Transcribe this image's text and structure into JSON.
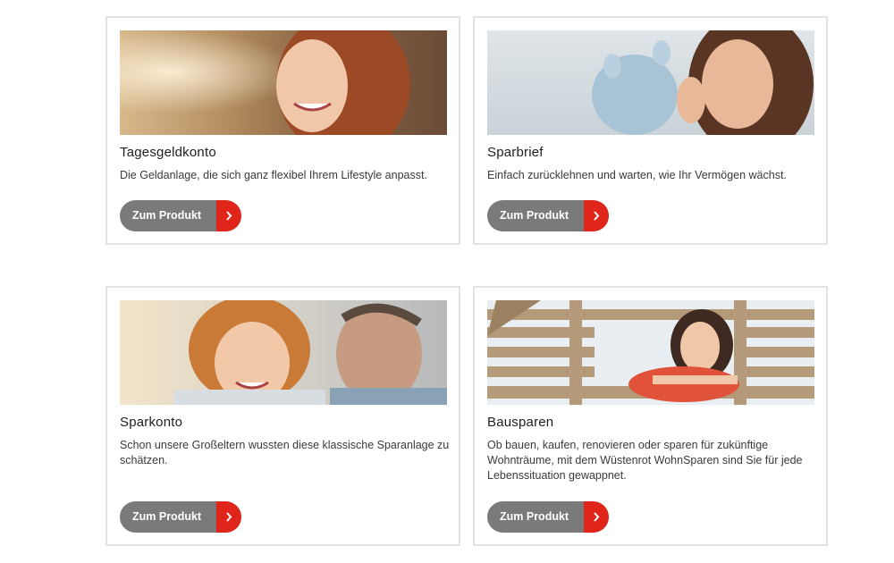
{
  "cards": [
    {
      "title": "Tagesgeldkonto",
      "description": "Die Geldanlage, die sich ganz flexibel Ihrem Lifestyle anpasst.",
      "button_label": "Zum Produkt",
      "image": "woman-smiling-photo"
    },
    {
      "title": "Sparbrief",
      "description": "Einfach zurücklehnen und warten, wie Ihr Vermögen wächst.",
      "button_label": "Zum Produkt",
      "image": "woman-with-piggy-bank-photo"
    },
    {
      "title": "Sparkonto",
      "description": "Schon unsere Großeltern wussten diese klassische Sparanlage zu schätzen.",
      "button_label": "Zum Produkt",
      "image": "boy-and-grandfather-photo"
    },
    {
      "title": "Bausparen",
      "description": "Ob bauen, kaufen, renovieren oder sparen für zukünftige Wohnträume, mit dem Wüstenrot WohnSparen sind Sie für jede Lebenssituation gewappnet.",
      "button_label": "Zum Produkt",
      "image": "woman-in-wooden-house-photo"
    }
  ],
  "colors": {
    "button_gray": "#7a7a7a",
    "button_accent": "#e0261b",
    "card_border": "#e3e3e3"
  },
  "icons": {
    "button_arrow": "chevron-right-icon"
  }
}
